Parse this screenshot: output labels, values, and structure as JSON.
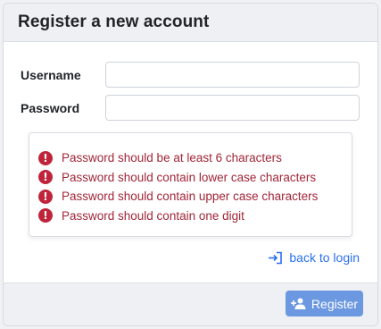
{
  "header": {
    "title": "Register a new account"
  },
  "form": {
    "username_label": "Username",
    "username_value": "",
    "password_label": "Password",
    "password_value": ""
  },
  "errors": [
    "Password should be at least 6 characters",
    "Password should contain lower case characters",
    "Password should contain upper case characters",
    "Password should contain one digit"
  ],
  "links": {
    "back_to_login": "back to login"
  },
  "footer": {
    "register_label": "Register"
  },
  "icons": {
    "error": "exclamation-circle-icon",
    "back": "sign-in-icon",
    "register": "user-plus-icon"
  },
  "colors": {
    "error": "#c0243a",
    "link": "#2a6ff0",
    "primary_button": "#6b98e0"
  }
}
